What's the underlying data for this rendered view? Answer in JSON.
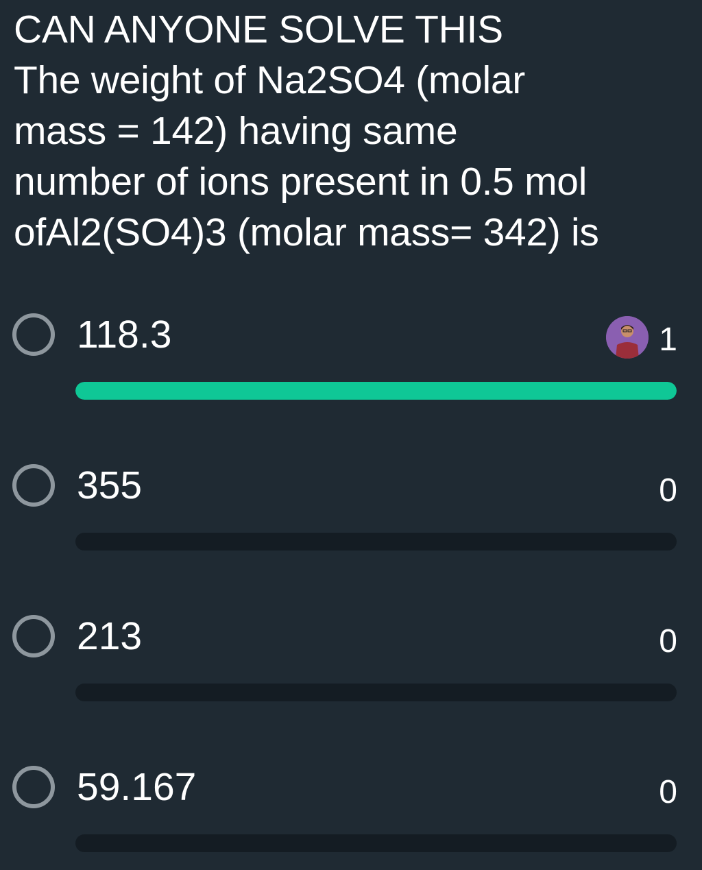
{
  "question": {
    "lines": [
      "CAN ANYONE SOLVE THIS",
      "The weight of Na2SO4 (molar",
      "mass = 142) having same",
      "number of ions present in 0.5 mol",
      "ofAl2(SO4)3 (molar mass= 342) is"
    ]
  },
  "options": [
    {
      "label": "118.3",
      "count": "1",
      "vote_fraction": 1.0,
      "has_voter_avatar": true
    },
    {
      "label": "355",
      "count": "0",
      "vote_fraction": 0.0,
      "has_voter_avatar": false
    },
    {
      "label": "213",
      "count": "0",
      "vote_fraction": 0.0,
      "has_voter_avatar": false
    },
    {
      "label": "59.167",
      "count": "0",
      "vote_fraction": 0.0,
      "has_voter_avatar": false
    }
  ],
  "colors": {
    "background": "#1f2a33",
    "bar_fill": "#0fc796",
    "bar_track": "#141c23",
    "radio_border": "#8e979e",
    "avatar_bg": "#8a5fb1"
  },
  "icons": {
    "radio": "radio-unselected-icon",
    "avatar": "voter-avatar-icon"
  }
}
